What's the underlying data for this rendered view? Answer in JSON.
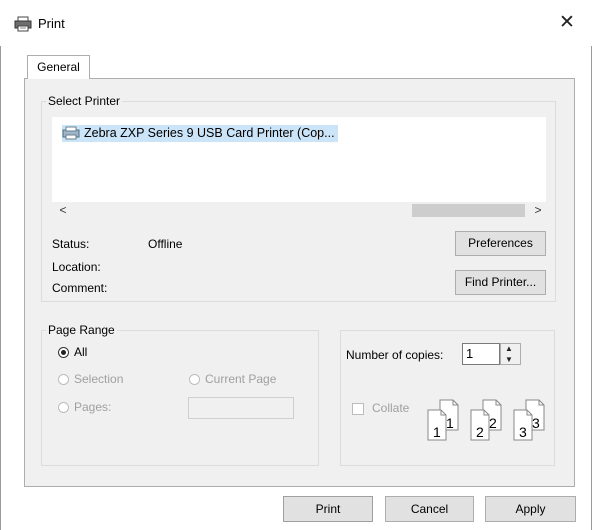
{
  "window": {
    "title": "Print",
    "icon": "printer-icon",
    "close_glyph": "✕"
  },
  "tabs": [
    {
      "label": "General"
    }
  ],
  "select_printer": {
    "legend": "Select Printer",
    "printer_name": "Zebra ZXP Series 9 USB Card Printer (Cop...",
    "scroll_left": "<",
    "scroll_right": ">",
    "status_label": "Status:",
    "status_value": "Offline",
    "location_label": "Location:",
    "comment_label": "Comment:",
    "preferences_label": "Preferences",
    "find_printer_label": "Find Printer..."
  },
  "page_range": {
    "legend": "Page Range",
    "all_label": "All",
    "selection_label": "Selection",
    "current_page_label": "Current Page",
    "pages_label": "Pages:",
    "selected": "All"
  },
  "copies": {
    "label": "Number of copies:",
    "value": "1",
    "collate_label": "Collate",
    "collate_checked": false
  },
  "buttons": {
    "print": "Print",
    "cancel": "Cancel",
    "apply": "Apply"
  },
  "colors": {
    "selection_highlight": "#cce4f7",
    "panel": "#f0f0f0",
    "button": "#e1e1e1"
  }
}
